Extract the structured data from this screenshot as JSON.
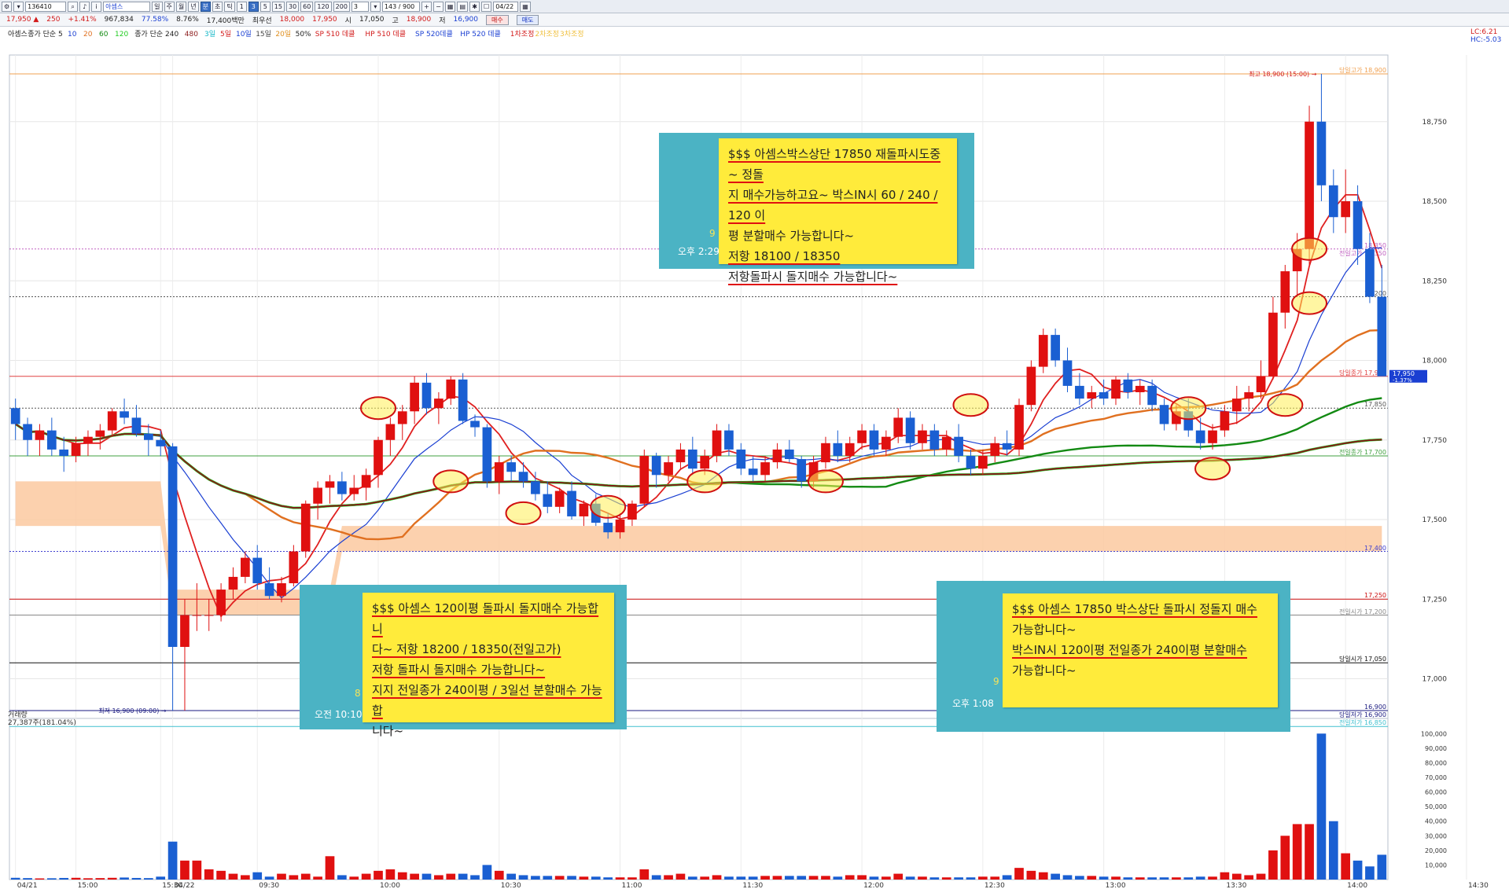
{
  "toolbar": {
    "code": "136410",
    "stock_name": "아셈스",
    "periods": [
      "일",
      "주",
      "월",
      "년",
      "분",
      "초",
      "틱"
    ],
    "minute_buttons": [
      "1",
      "3",
      "5",
      "15",
      "30",
      "60",
      "120",
      "200"
    ],
    "interval_value": "3",
    "count": "143 / 900",
    "date": "04/22"
  },
  "quote": {
    "price": "17,950",
    "change": "250",
    "change_pct": "+1.41%",
    "volume": "967,834",
    "pct1": "77.58%",
    "pct2": "8.76%",
    "amount": "17,400백만",
    "priority_label": "최우선",
    "ask": "18,000",
    "bid": "17,950",
    "open_label": "시",
    "open": "17,050",
    "high_label": "고",
    "high": "18,900",
    "low_label": "저",
    "low": "16,900",
    "buy_label": "매수",
    "sell_label": "매도"
  },
  "legend": [
    {
      "text": "아셈스",
      "color": "#222222"
    },
    {
      "text": "종가 단순 5",
      "color": "#222222"
    },
    {
      "text": "10",
      "color": "#1a3fd2"
    },
    {
      "text": "20",
      "color": "#e07020"
    },
    {
      "text": "60",
      "color": "#138a13"
    },
    {
      "text": "120",
      "color": "#22cc22"
    },
    {
      "text": "종가 단순 240",
      "color": "#222222"
    },
    {
      "text": "480",
      "color": "#8b1a1a"
    },
    {
      "text": "3일",
      "color": "#16b8c8"
    },
    {
      "text": "5일",
      "color": "#d21a1a"
    },
    {
      "text": "10일",
      "color": "#1a3fd2"
    },
    {
      "text": "15일",
      "color": "#444444"
    },
    {
      "text": "20일",
      "color": "#e09020"
    },
    {
      "text": "50%",
      "color": "#222222"
    },
    {
      "text": "SP 510 데클",
      "color": "#d21a1a"
    },
    {
      "text": "HP 510 데클",
      "color": "#d21a1a"
    },
    {
      "text": "SP 520데클",
      "color": "#1a3fd2"
    },
    {
      "text": "HP 520 데클",
      "color": "#1a3fd2"
    },
    {
      "text": "1차조정",
      "color": "#d21a1a"
    },
    {
      "text": "2차조정",
      "color": "#f0c040"
    },
    {
      "text": "3차조정",
      "color": "#f0c040"
    }
  ],
  "corner_indicators": [
    "LC:6.21",
    "HC:-5.03"
  ],
  "volume_panel": {
    "title": "거래량",
    "value": "27,387주(181.04%)"
  },
  "chart_data": {
    "type": "candlestick",
    "price_axis": {
      "ticks": [
        18750,
        18500,
        18250,
        18000,
        17750,
        17500,
        17250,
        17000
      ],
      "range": [
        16900,
        18900
      ]
    },
    "volume_axis": {
      "ticks": [
        100000,
        90000,
        80000,
        70000,
        60000,
        50000,
        40000,
        30000,
        20000,
        10000
      ],
      "range": [
        0,
        105000
      ]
    },
    "time_labels": [
      {
        "t": "04/21",
        "i": 0
      },
      {
        "t": "15:00",
        "i": 5
      },
      {
        "t": "15:30",
        "i": 12
      },
      {
        "t": "04/22",
        "i": 13
      },
      {
        "t": "09:30",
        "i": 20
      },
      {
        "t": "10:00",
        "i": 30
      },
      {
        "t": "10:30",
        "i": 40
      },
      {
        "t": "11:00",
        "i": 50
      },
      {
        "t": "11:30",
        "i": 60
      },
      {
        "t": "12:00",
        "i": 70
      },
      {
        "t": "12:30",
        "i": 80
      },
      {
        "t": "13:00",
        "i": 90
      },
      {
        "t": "13:30",
        "i": 100
      },
      {
        "t": "14:00",
        "i": 110
      },
      {
        "t": "14:30",
        "i": 120
      },
      {
        "t": "15:00",
        "i": 130
      },
      {
        "t": "15:30:00",
        "i": 145
      }
    ],
    "levels": [
      {
        "label": "당일고가 18,900",
        "value": 18900,
        "color": "#f0a050",
        "style": "solid"
      },
      {
        "label": "18,350",
        "value": 18350,
        "color": "#c060c0",
        "style": "dot"
      },
      {
        "label": "전일고가 18,350",
        "value": 18350,
        "color": "#c060c0",
        "style": "none"
      },
      {
        "label": "18,200",
        "value": 18200,
        "color": "#555555",
        "style": "dot"
      },
      {
        "label": "당일종가 17,950",
        "value": 17950,
        "color": "#e04040",
        "style": "solid"
      },
      {
        "label": "17,850",
        "value": 17850,
        "color": "#555555",
        "style": "dot"
      },
      {
        "label": "전일종가 17,700",
        "value": 17700,
        "color": "#40a040",
        "style": "solid"
      },
      {
        "label": "17,400",
        "value": 17400,
        "color": "#4040d0",
        "style": "dot"
      },
      {
        "label": "17,250",
        "value": 17250,
        "color": "#cc1010",
        "style": "solid"
      },
      {
        "label": "전일시가 17,200",
        "value": 17200,
        "color": "#888888",
        "style": "solid"
      },
      {
        "label": "당일시가 17,050",
        "value": 17050,
        "color": "#111111",
        "style": "solid"
      },
      {
        "label": "16,900",
        "value": 16900,
        "color": "#1a1a80",
        "style": "solid"
      },
      {
        "label": "당일저가 16,900",
        "value": 16900,
        "color": "#1a1a80",
        "style": "none"
      },
      {
        "label": "전일저가 16,850",
        "value": 16850,
        "color": "#40c0d0",
        "style": "solid"
      }
    ],
    "last_price_tag": {
      "value": "17,950",
      "pct": "-1.37%"
    },
    "annotations": {
      "high": "최고 18,900 (15:00) →",
      "low": "최저 16,900 (09:00) →"
    },
    "candles": [
      [
        17850,
        17880,
        17750,
        17800,
        1200
      ],
      [
        17800,
        17820,
        17700,
        17750,
        1000
      ],
      [
        17750,
        17800,
        17700,
        17780,
        800
      ],
      [
        17780,
        17820,
        17700,
        17720,
        900
      ],
      [
        17720,
        17760,
        17650,
        17700,
        1100
      ],
      [
        17700,
        17760,
        17680,
        17740,
        1200
      ],
      [
        17740,
        17780,
        17700,
        17760,
        900
      ],
      [
        17760,
        17800,
        17720,
        17780,
        1000
      ],
      [
        17780,
        17850,
        17760,
        17840,
        1200
      ],
      [
        17840,
        17880,
        17800,
        17820,
        1400
      ],
      [
        17820,
        17860,
        17760,
        17770,
        1100
      ],
      [
        17770,
        17800,
        17700,
        17750,
        1000
      ],
      [
        17750,
        17780,
        17700,
        17730,
        2000
      ],
      [
        17730,
        17740,
        16900,
        17100,
        26000
      ],
      [
        17100,
        17250,
        16900,
        17200,
        13000
      ],
      [
        17200,
        17300,
        17150,
        17200,
        13000
      ],
      [
        17200,
        17250,
        17150,
        17200,
        7000
      ],
      [
        17200,
        17300,
        17180,
        17280,
        6000
      ],
      [
        17280,
        17350,
        17250,
        17320,
        4000
      ],
      [
        17320,
        17400,
        17300,
        17380,
        3000
      ],
      [
        17380,
        17420,
        17280,
        17300,
        5000
      ],
      [
        17300,
        17350,
        17250,
        17260,
        2000
      ],
      [
        17260,
        17320,
        17240,
        17300,
        4000
      ],
      [
        17300,
        17420,
        17290,
        17400,
        3000
      ],
      [
        17400,
        17560,
        17380,
        17550,
        4000
      ],
      [
        17550,
        17620,
        17500,
        17600,
        2000
      ],
      [
        17600,
        17640,
        17550,
        17620,
        16000
      ],
      [
        17620,
        17650,
        17560,
        17580,
        3000
      ],
      [
        17580,
        17640,
        17560,
        17600,
        2000
      ],
      [
        17600,
        17660,
        17560,
        17640,
        4000
      ],
      [
        17640,
        17760,
        17600,
        17750,
        6000
      ],
      [
        17750,
        17820,
        17700,
        17800,
        7000
      ],
      [
        17800,
        17860,
        17750,
        17840,
        5000
      ],
      [
        17840,
        17950,
        17800,
        17930,
        4000
      ],
      [
        17930,
        17960,
        17830,
        17850,
        4000
      ],
      [
        17850,
        17900,
        17800,
        17880,
        3000
      ],
      [
        17880,
        17950,
        17860,
        17940,
        4000
      ],
      [
        17940,
        17960,
        17800,
        17810,
        4000
      ],
      [
        17810,
        17830,
        17760,
        17790,
        3000
      ],
      [
        17790,
        17800,
        17600,
        17620,
        10000
      ],
      [
        17620,
        17700,
        17580,
        17680,
        6000
      ],
      [
        17680,
        17700,
        17620,
        17650,
        4000
      ],
      [
        17650,
        17680,
        17600,
        17620,
        3000
      ],
      [
        17620,
        17650,
        17560,
        17580,
        2500
      ],
      [
        17580,
        17620,
        17520,
        17540,
        2500
      ],
      [
        17540,
        17600,
        17520,
        17590,
        2500
      ],
      [
        17590,
        17620,
        17500,
        17510,
        2500
      ],
      [
        17510,
        17560,
        17480,
        17550,
        2000
      ],
      [
        17550,
        17580,
        17480,
        17490,
        2000
      ],
      [
        17490,
        17520,
        17440,
        17460,
        1500
      ],
      [
        17460,
        17520,
        17440,
        17500,
        1500
      ],
      [
        17500,
        17560,
        17480,
        17550,
        1500
      ],
      [
        17550,
        17720,
        17540,
        17700,
        7000
      ],
      [
        17700,
        17710,
        17600,
        17640,
        3000
      ],
      [
        17640,
        17700,
        17620,
        17680,
        3000
      ],
      [
        17680,
        17740,
        17660,
        17720,
        4000
      ],
      [
        17720,
        17760,
        17640,
        17660,
        2000
      ],
      [
        17660,
        17720,
        17640,
        17700,
        2000
      ],
      [
        17700,
        17800,
        17680,
        17780,
        3000
      ],
      [
        17780,
        17800,
        17700,
        17720,
        2000
      ],
      [
        17720,
        17740,
        17640,
        17660,
        2000
      ],
      [
        17660,
        17700,
        17620,
        17640,
        2000
      ],
      [
        17640,
        17700,
        17620,
        17680,
        2500
      ],
      [
        17680,
        17740,
        17660,
        17720,
        2500
      ],
      [
        17720,
        17750,
        17680,
        17690,
        2500
      ],
      [
        17690,
        17700,
        17600,
        17620,
        2500
      ],
      [
        17620,
        17700,
        17600,
        17680,
        2500
      ],
      [
        17680,
        17760,
        17660,
        17740,
        2500
      ],
      [
        17740,
        17780,
        17680,
        17700,
        2000
      ],
      [
        17700,
        17760,
        17680,
        17740,
        3000
      ],
      [
        17740,
        17800,
        17720,
        17780,
        3000
      ],
      [
        17780,
        17800,
        17700,
        17720,
        2000
      ],
      [
        17720,
        17780,
        17700,
        17760,
        2000
      ],
      [
        17760,
        17850,
        17740,
        17820,
        4000
      ],
      [
        17820,
        17840,
        17720,
        17740,
        2000
      ],
      [
        17740,
        17800,
        17720,
        17780,
        2000
      ],
      [
        17780,
        17800,
        17700,
        17720,
        1500
      ],
      [
        17720,
        17780,
        17700,
        17760,
        1500
      ],
      [
        17760,
        17800,
        17680,
        17700,
        1500
      ],
      [
        17700,
        17720,
        17640,
        17660,
        1500
      ],
      [
        17660,
        17720,
        17640,
        17700,
        2000
      ],
      [
        17700,
        17760,
        17680,
        17740,
        2000
      ],
      [
        17740,
        17780,
        17700,
        17720,
        3000
      ],
      [
        17720,
        17880,
        17700,
        17860,
        8000
      ],
      [
        17860,
        18000,
        17840,
        17980,
        6000
      ],
      [
        17980,
        18100,
        17960,
        18080,
        5000
      ],
      [
        18080,
        18100,
        17980,
        18000,
        4000
      ],
      [
        18000,
        18040,
        17900,
        17920,
        3000
      ],
      [
        17920,
        17960,
        17860,
        17880,
        2500
      ],
      [
        17880,
        17920,
        17850,
        17900,
        2500
      ],
      [
        17900,
        17940,
        17860,
        17880,
        2000
      ],
      [
        17880,
        17950,
        17860,
        17940,
        2000
      ],
      [
        17940,
        17960,
        17880,
        17900,
        1500
      ],
      [
        17900,
        17940,
        17860,
        17920,
        1500
      ],
      [
        17920,
        17940,
        17840,
        17860,
        1500
      ],
      [
        17860,
        17880,
        17780,
        17800,
        1500
      ],
      [
        17800,
        17860,
        17780,
        17840,
        1500
      ],
      [
        17840,
        17880,
        17760,
        17780,
        1500
      ],
      [
        17780,
        17820,
        17720,
        17740,
        2000
      ],
      [
        17740,
        17800,
        17720,
        17780,
        2000
      ],
      [
        17780,
        17860,
        17760,
        17840,
        5000
      ],
      [
        17840,
        17920,
        17800,
        17880,
        4000
      ],
      [
        17880,
        17920,
        17840,
        17900,
        3000
      ],
      [
        17900,
        18000,
        17880,
        17950,
        4000
      ],
      [
        17950,
        18200,
        17940,
        18150,
        20000
      ],
      [
        18150,
        18300,
        18100,
        18280,
        30000
      ],
      [
        18280,
        18400,
        18200,
        18350,
        38000
      ],
      [
        18350,
        18800,
        18300,
        18750,
        38000
      ],
      [
        18750,
        18900,
        18500,
        18550,
        100000
      ],
      [
        18550,
        18600,
        18400,
        18450,
        40000
      ],
      [
        18450,
        18600,
        18400,
        18500,
        18000
      ],
      [
        18500,
        18550,
        18300,
        18350,
        13000
      ],
      [
        18350,
        18400,
        18180,
        18200,
        9000
      ],
      [
        18200,
        18300,
        18150,
        17950,
        17000
      ]
    ]
  },
  "callouts": {
    "top": {
      "lines": [
        "$$$ 아셈스박스상단 17850 재돌파시도중~ 정돌",
        "지 매수가능하고요~ 박스IN시 60 / 240 / 120 이",
        "평 분할매수 가능합니다~",
        "저항 18100 / 18350",
        "저항돌파시 돌지매수 가능합니다~"
      ],
      "num": "9",
      "time": "오후 2:29"
    },
    "left": {
      "lines": [
        "$$$ 아셈스 120이평 돌파시 돌지매수 가능합니",
        "다~ 저항 18200 / 18350(전일고가)",
        "저항 돌파시 돌지매수 가능합니다~",
        "지지 전일종가 240이평 / 3일선 분할매수 가능합",
        "니다~"
      ],
      "num": "8",
      "time": "오전 10:10"
    },
    "right": {
      "lines": [
        "$$$ 아셈스 17850 박스상단 돌파시 정돌지 매수",
        "가능합니다~",
        "박스IN시 120이평 전일종가 240이평 분할매수",
        "가능합니다~"
      ],
      "num": "9",
      "time": "오후 1:08"
    }
  }
}
